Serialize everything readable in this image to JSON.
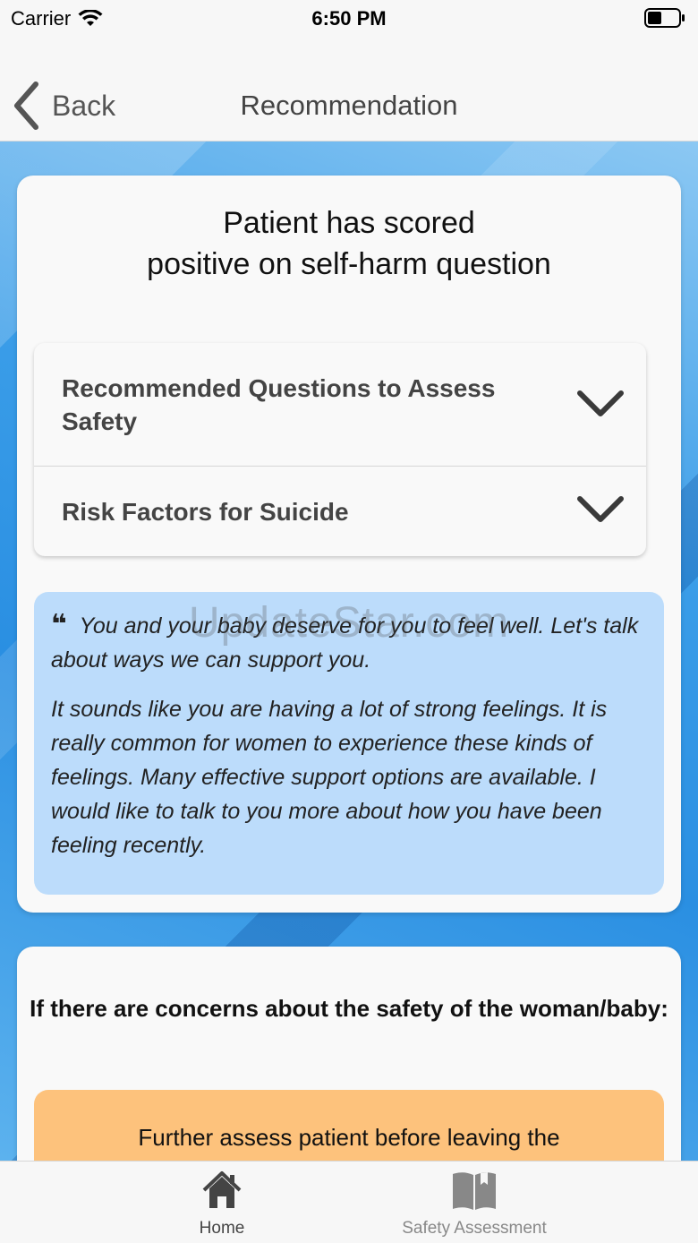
{
  "status_bar": {
    "carrier": "Carrier",
    "time": "6:50 PM"
  },
  "nav": {
    "back_label": "Back",
    "title": "Recommendation"
  },
  "main_card": {
    "title_line1": "Patient has scored",
    "title_line2": "positive on self-harm question",
    "accordion": [
      {
        "label": "Recommended Questions to Assess Safety"
      },
      {
        "label": "Risk Factors for Suicide"
      }
    ],
    "quote": {
      "paragraph1": "You and your baby deserve for you to feel well. Let's talk about ways we can support you.",
      "paragraph2": "It sounds like you are having a lot of strong feelings. It is really common for women to experience these kinds of feelings. Many effective support options are available. I would like to talk to you more about how you have been feeling recently."
    }
  },
  "watermark": "UpdateStar.com",
  "safety_card": {
    "title": "If there are concerns about the safety of the woman/baby:",
    "action_text": "Further assess patient before leaving the"
  },
  "tab_bar": {
    "tabs": [
      {
        "label": "Home",
        "icon": "home-icon",
        "active": true
      },
      {
        "label": "Safety Assessment",
        "icon": "book-icon",
        "active": false
      }
    ]
  },
  "colors": {
    "quote_bg": "#bcdcfb",
    "action_bg": "#fdc27c",
    "background_blue": "#2a8fe2"
  }
}
